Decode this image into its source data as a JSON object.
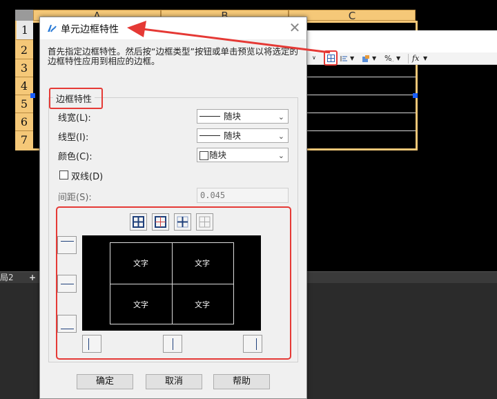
{
  "sheet": {
    "columns": [
      "A",
      "B",
      "C"
    ],
    "rows": [
      "1",
      "2",
      "3",
      "4",
      "5",
      "6",
      "7"
    ],
    "sheet_tab": "局2",
    "add_tab": "+"
  },
  "toolbar": {
    "fx_label": "fx",
    "percent_label": "%"
  },
  "dialog": {
    "title": "单元边框特性",
    "description": "首先指定边框特性。然后按“边框类型”按钮或单击预览以将选定的边框特性应用到相应的边框。",
    "group_title": "边框特性",
    "line_width_label": "线宽(L):",
    "line_width_value": "随块",
    "line_type_label": "线型(I):",
    "line_type_value": "随块",
    "color_label": "颜色(C):",
    "color_value": "随块",
    "double_line_label": "双线(D)",
    "spacing_label": "间距(S):",
    "spacing_value": "0.045",
    "preview_cells": [
      "文字",
      "文字",
      "文字",
      "文字"
    ],
    "ok_label": "确定",
    "cancel_label": "取消",
    "help_label": "帮助"
  },
  "colors": {
    "header_orange": "#f5c878",
    "highlight_red": "#e53935",
    "handle_blue": "#1a5fff"
  }
}
